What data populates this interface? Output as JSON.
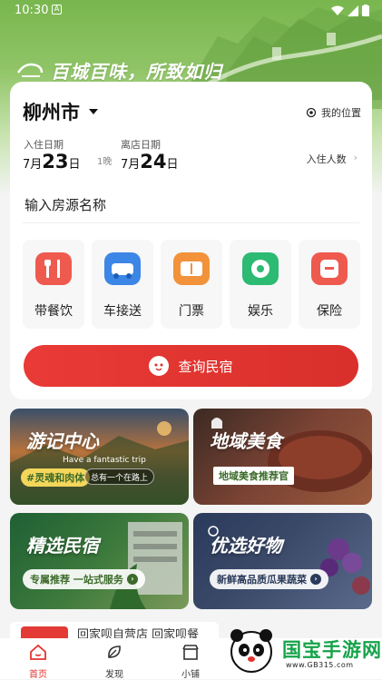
{
  "status": {
    "time": "10:30",
    "app_badge": "A"
  },
  "hero": {
    "slogan": "百城百味，所致如归"
  },
  "search": {
    "city": "柳州市",
    "my_location": "我的位置",
    "checkin_label": "入住日期",
    "checkin_month": "7月",
    "checkin_day": "23",
    "checkin_unit": "日",
    "nights": "1晚",
    "checkout_label": "离店日期",
    "checkout_month": "7月",
    "checkout_day": "24",
    "checkout_unit": "日",
    "guests_label": "入住人数",
    "house_placeholder": "输入房源名称",
    "search_button": "查询民宿"
  },
  "services": [
    {
      "label": "带餐饮",
      "icon": "dining-icon",
      "color": "#e8443a"
    },
    {
      "label": "车接送",
      "icon": "car-icon",
      "color": "#2f7fe0"
    },
    {
      "label": "门票",
      "icon": "ticket-icon",
      "color": "#f08a24"
    },
    {
      "label": "娱乐",
      "icon": "entertainment-icon",
      "color": "#27b36b"
    },
    {
      "label": "保险",
      "icon": "insurance-icon",
      "color": "#e8443a"
    }
  ],
  "tiles": {
    "travel": {
      "title": "游记中心",
      "subtitle": "Have a fantastic trip",
      "tag": "#灵魂和肉体",
      "note": "总有一个在路上"
    },
    "food": {
      "title": "地域美食",
      "tag": "地域美食推荐官"
    },
    "homestay": {
      "title": "精选民宿",
      "pill": "专属推荐 一站式服务"
    },
    "goods": {
      "title": "优选好物",
      "pill": "新鲜高品质瓜果蔬菜"
    }
  },
  "banner": {
    "text": "回家呗自营店 回家呗餐"
  },
  "tabbar": [
    {
      "label": "首页",
      "icon": "home-icon",
      "active": true
    },
    {
      "label": "发现",
      "icon": "discover-icon",
      "active": false
    },
    {
      "label": "小铺",
      "icon": "shop-icon",
      "active": false
    }
  ],
  "watermark": {
    "brand": "国宝手游网",
    "url": "www.GB315.com"
  },
  "colors": {
    "accent": "#e5332f",
    "hero_green": "#7db852"
  }
}
